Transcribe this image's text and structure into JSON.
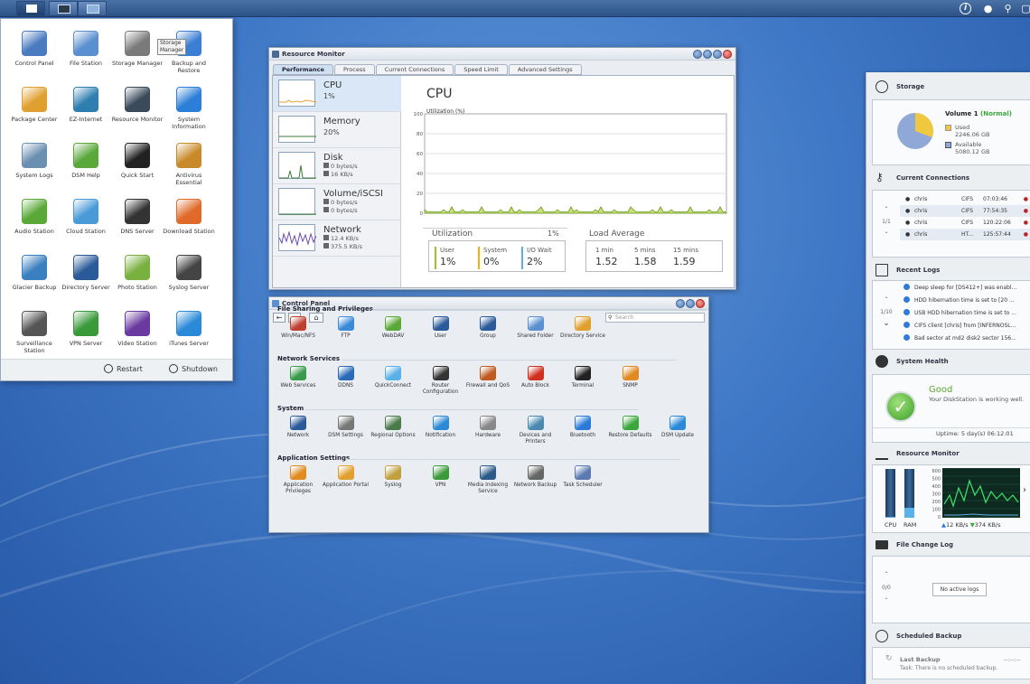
{
  "taskbar": {
    "buttons": [
      "main-menu",
      "resource-monitor",
      "control-panel"
    ],
    "right_icons": [
      "info-icon",
      "user-icon",
      "search-icon",
      "widgets-icon"
    ]
  },
  "main_menu": {
    "tooltip": "Storage Manager",
    "items": [
      {
        "label": "Control Panel",
        "icon": "control-panel-icon",
        "color": "#4a7bc0"
      },
      {
        "label": "File Station",
        "icon": "file-station-icon",
        "color": "#5a8fd0"
      },
      {
        "label": "Storage Manager",
        "icon": "storage-manager-icon",
        "color": "#7a7a7a"
      },
      {
        "label": "Backup and Restore",
        "icon": "backup-restore-icon",
        "color": "#3b7fd4"
      },
      {
        "label": "Package Center",
        "icon": "package-center-icon",
        "color": "#e0a030"
      },
      {
        "label": "EZ-Internet",
        "icon": "ez-internet-icon",
        "color": "#2e7fb0"
      },
      {
        "label": "Resource Monitor",
        "icon": "resource-monitor-icon",
        "color": "#3a4a5a"
      },
      {
        "label": "System Information",
        "icon": "info-icon",
        "color": "#2c7fd8"
      },
      {
        "label": "System Logs",
        "icon": "system-logs-icon",
        "color": "#6a8fb0"
      },
      {
        "label": "DSM Help",
        "icon": "dsm-help-icon",
        "color": "#58a83a"
      },
      {
        "label": "Quick Start",
        "icon": "quick-start-icon",
        "color": "#222222"
      },
      {
        "label": "Antivirus Essential",
        "icon": "antivirus-icon",
        "color": "#c88a2a"
      },
      {
        "label": "Audio Station",
        "icon": "audio-station-icon",
        "color": "#5aa838"
      },
      {
        "label": "Cloud Station",
        "icon": "cloud-station-icon",
        "color": "#4a9ad8"
      },
      {
        "label": "DNS Server",
        "icon": "dns-server-icon",
        "color": "#333333"
      },
      {
        "label": "Download Station",
        "icon": "download-station-icon",
        "color": "#e06a2a"
      },
      {
        "label": "Glacier Backup",
        "icon": "glacier-backup-icon",
        "color": "#3a7fc0"
      },
      {
        "label": "Directory Server",
        "icon": "directory-server-icon",
        "color": "#2a5a9a"
      },
      {
        "label": "Photo Station",
        "icon": "photo-station-icon",
        "color": "#7ab040"
      },
      {
        "label": "Syslog Server",
        "icon": "syslog-server-icon",
        "color": "#444444"
      },
      {
        "label": "Surveillance Station",
        "icon": "surveillance-icon",
        "color": "#555555"
      },
      {
        "label": "VPN Server",
        "icon": "vpn-server-icon",
        "color": "#3a9a3a"
      },
      {
        "label": "Video Station",
        "icon": "video-station-icon",
        "color": "#6a3aa0"
      },
      {
        "label": "iTunes Server",
        "icon": "itunes-server-icon",
        "color": "#2a8ad8"
      }
    ],
    "restart": "Restart",
    "shutdown": "Shutdown"
  },
  "resource_monitor": {
    "title": "Resource Monitor",
    "tabs": [
      "Performance",
      "Process",
      "Current Connections",
      "Speed Limit",
      "Advanced Settings"
    ],
    "side": [
      {
        "name": "CPU",
        "value": "1%"
      },
      {
        "name": "Memory",
        "value": "20%"
      },
      {
        "name": "Disk",
        "v1": "0 bytes/s",
        "v2": "16 KB/s"
      },
      {
        "name": "Volume/iSCSI",
        "v1": "0 bytes/s",
        "v2": "0 bytes/s"
      },
      {
        "name": "Network",
        "v1": "12.4 KB/s",
        "v2": "375.5 KB/s"
      }
    ],
    "main_title": "CPU",
    "chart_label": "Utilization (%)",
    "y_ticks": [
      "100",
      "80",
      "60",
      "40",
      "20",
      "0"
    ],
    "utilization_label": "Utilization",
    "utilization_value": "1%",
    "metrics": [
      {
        "label": "User",
        "value": "1%",
        "color": "#9ac42a"
      },
      {
        "label": "System",
        "value": "0%",
        "color": "#f0b400"
      },
      {
        "label": "I/O Wait",
        "value": "2%",
        "color": "#5ab0e8"
      }
    ],
    "load_label": "Load Average",
    "loads": [
      {
        "label": "1 min",
        "value": "1.52"
      },
      {
        "label": "5 mins",
        "value": "1.58"
      },
      {
        "label": "15 mins",
        "value": "1.59"
      }
    ]
  },
  "control_panel": {
    "title": "Control Panel",
    "search_placeholder": "Search",
    "sections": [
      {
        "title": "File Sharing and Privileges",
        "items": [
          {
            "label": "Win/Mac/NFS",
            "icon": "win-mac-nfs-icon",
            "color": "#c04030"
          },
          {
            "label": "FTP",
            "icon": "ftp-icon",
            "color": "#3a8ad8"
          },
          {
            "label": "WebDAV",
            "icon": "webdav-icon",
            "color": "#5aa838"
          },
          {
            "label": "User",
            "icon": "user-icon",
            "color": "#2a5a9a"
          },
          {
            "label": "Group",
            "icon": "group-icon",
            "color": "#2a5a9a"
          },
          {
            "label": "Shared Folder",
            "icon": "shared-folder-icon",
            "color": "#5a8fd0"
          },
          {
            "label": "Directory Service",
            "icon": "directory-service-icon",
            "color": "#e0a030"
          }
        ]
      },
      {
        "title": "Network Services",
        "items": [
          {
            "label": "Web Services",
            "icon": "web-services-icon",
            "color": "#3a9a4a"
          },
          {
            "label": "DDNS",
            "icon": "ddns-icon",
            "color": "#2a6ab8"
          },
          {
            "label": "QuickConnect",
            "icon": "quickconnect-icon",
            "color": "#5ab0e8"
          },
          {
            "label": "Router Configuration",
            "icon": "router-icon",
            "color": "#333333"
          },
          {
            "label": "Firewall and QoS",
            "icon": "firewall-icon",
            "color": "#c05a20"
          },
          {
            "label": "Auto Block",
            "icon": "auto-block-icon",
            "color": "#d03020"
          },
          {
            "label": "Terminal",
            "icon": "terminal-icon",
            "color": "#222222"
          },
          {
            "label": "SNMP",
            "icon": "snmp-icon",
            "color": "#e08a20"
          }
        ]
      },
      {
        "title": "System",
        "items": [
          {
            "label": "Network",
            "icon": "network-icon",
            "color": "#2a5a9a"
          },
          {
            "label": "DSM Settings",
            "icon": "dsm-settings-icon",
            "color": "#777777"
          },
          {
            "label": "Regional Options",
            "icon": "regional-options-icon",
            "color": "#4a7a4a"
          },
          {
            "label": "Notification",
            "icon": "notification-icon",
            "color": "#2a8ad8"
          },
          {
            "label": "Hardware",
            "icon": "hardware-icon",
            "color": "#888888"
          },
          {
            "label": "Devices and Printers",
            "icon": "printer-icon",
            "color": "#4a8ab0"
          },
          {
            "label": "Bluetooth",
            "icon": "bluetooth-icon",
            "color": "#2a7ad8"
          },
          {
            "label": "Restore Defaults",
            "icon": "restore-defaults-icon",
            "color": "#3aa83a"
          },
          {
            "label": "DSM Update",
            "icon": "dsm-update-icon",
            "color": "#2a8ad8"
          }
        ]
      },
      {
        "title": "Application Settings",
        "items": [
          {
            "label": "Application Privileges",
            "icon": "app-privileges-icon",
            "color": "#e08a20"
          },
          {
            "label": "Application Portal",
            "icon": "app-portal-icon",
            "color": "#e0a030"
          },
          {
            "label": "Syslog",
            "icon": "syslog-icon",
            "color": "#c0a040"
          },
          {
            "label": "VPN",
            "icon": "vpn-icon",
            "color": "#3a9a3a"
          },
          {
            "label": "Media Indexing Service",
            "icon": "media-indexing-icon",
            "color": "#2a5a8a"
          },
          {
            "label": "Network Backup",
            "icon": "network-backup-icon",
            "color": "#666666"
          },
          {
            "label": "Task Scheduler",
            "icon": "task-scheduler-icon",
            "color": "#5a7ab0"
          }
        ]
      }
    ]
  },
  "widgets": {
    "storage": {
      "title": "Storage",
      "volume": "Volume 1",
      "status": "(Normal)",
      "used_label": "Used",
      "used": "2246.06 GB",
      "available_label": "Available",
      "available": "5080.12 GB",
      "used_color": "#f0c840",
      "avail_color": "#8fa8d8"
    },
    "connections": {
      "title": "Current Connections",
      "page": "1/1",
      "rows": [
        {
          "user": "chris",
          "type": "CIFS",
          "time": "07:03:46"
        },
        {
          "user": "chris",
          "type": "CIFS",
          "time": "77:54:35"
        },
        {
          "user": "chris",
          "type": "CIFS",
          "time": "120:22:06"
        },
        {
          "user": "chris",
          "type": "HT...",
          "time": "125:57:44"
        }
      ]
    },
    "logs": {
      "title": "Recent Logs",
      "page": "1/10",
      "rows": [
        "Deep sleep for [DS412+] was enabl...",
        "HDD hibernation time is set to [20 ...",
        "USB HDD hibernation time is set to ...",
        "CIFS client [chris] from [INFERNOSL...",
        "Bad sector at md2 disk2 sector 156..."
      ]
    },
    "health": {
      "title": "System Health",
      "status": "Good",
      "message": "Your DiskStation is working well.",
      "uptime": "Uptime: 5 day(s) 06:12:01"
    },
    "resource": {
      "title": "Resource Monitor",
      "cpu_label": "CPU",
      "ram_label": "RAM",
      "y_ticks": [
        "600",
        "500",
        "400",
        "300",
        "200",
        "100",
        "0"
      ],
      "up": "12 KB/s",
      "down": "374 KB/s"
    },
    "filelog": {
      "title": "File Change Log",
      "page": "0/0",
      "empty": "No active logs"
    },
    "backup": {
      "title": "Scheduled Backup",
      "last_label": "Last Backup",
      "last_value": "--:--:--",
      "task": "Task: There is no scheduled backup."
    }
  }
}
